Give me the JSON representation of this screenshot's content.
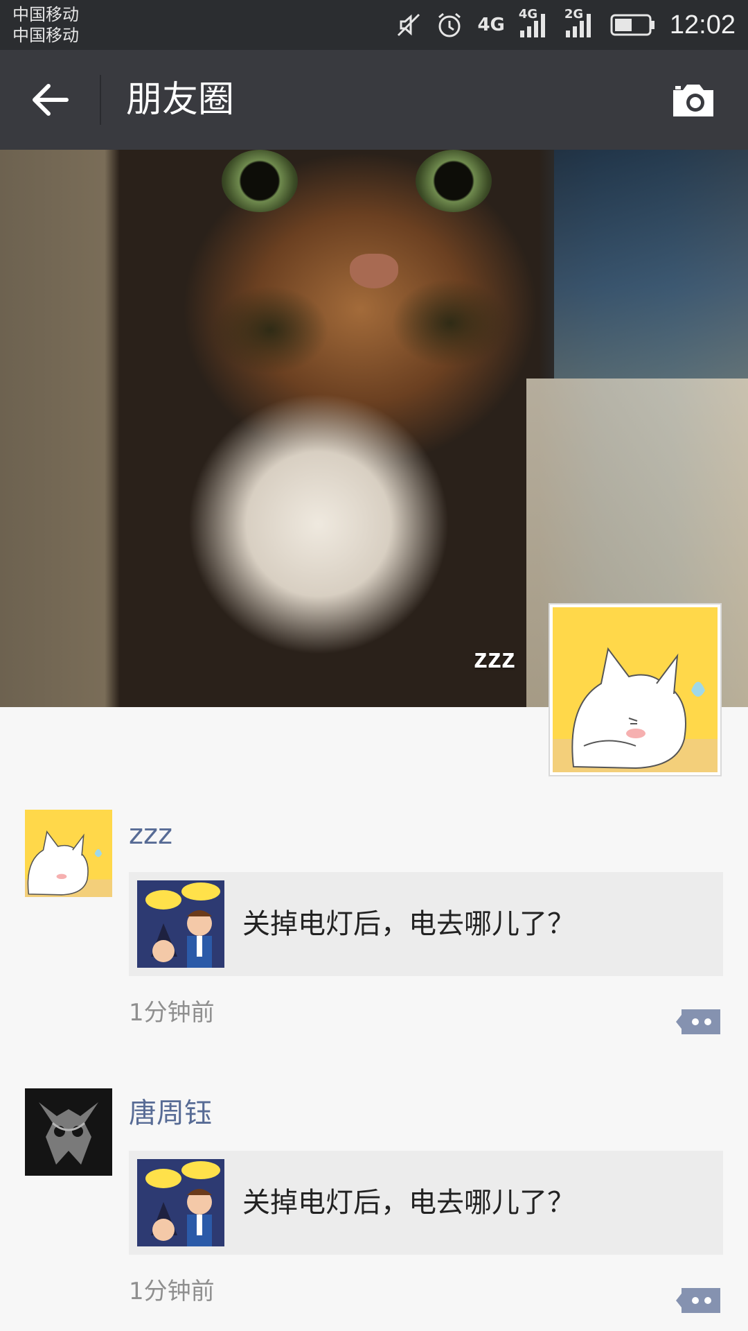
{
  "status_bar": {
    "carrier_1": "中国移动",
    "carrier_2": "中国移动",
    "network_1": "4G",
    "network_2": "4G",
    "network_3": "2G",
    "time": "12:02"
  },
  "nav": {
    "title": "朋友圈"
  },
  "cover": {
    "user_name": "zzz"
  },
  "feed": [
    {
      "name": "zzz",
      "share_title": "关掉电灯后，电去哪儿了？",
      "time": "1分钟前"
    },
    {
      "name": "唐周钰",
      "share_title": "关掉电灯后，电去哪儿了？",
      "time": "1分钟前"
    }
  ],
  "colors": {
    "nav_bg": "#393a3f",
    "status_bg": "#2b2d30",
    "name_link": "#576b95",
    "page_bg": "#f7f7f7",
    "card_bg": "#ececec"
  },
  "icons": [
    "back-arrow-icon",
    "camera-icon",
    "mute-icon",
    "alarm-icon",
    "signal-icon",
    "battery-icon",
    "comment-icon"
  ]
}
